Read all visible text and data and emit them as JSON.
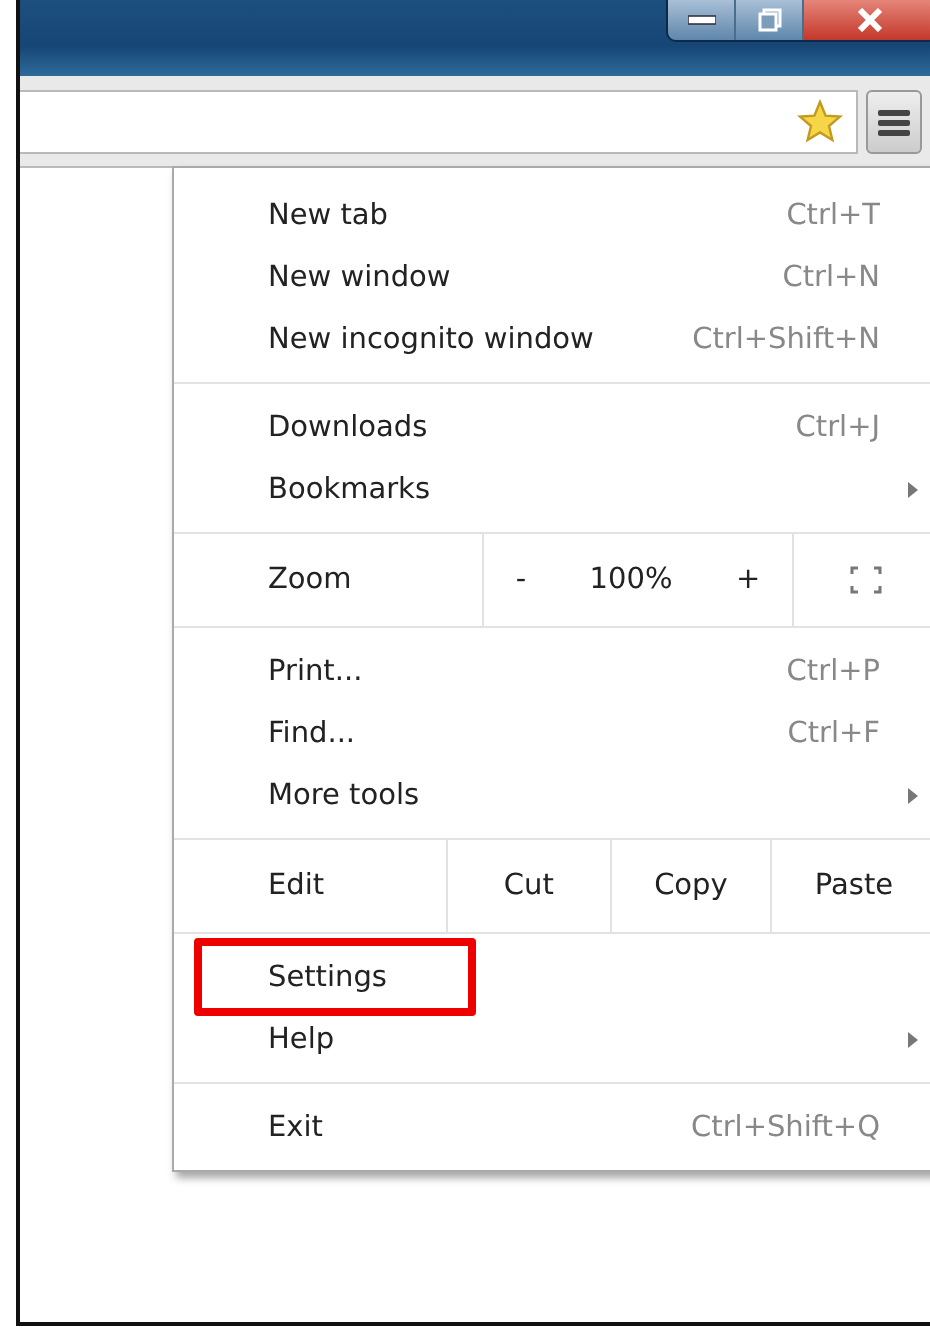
{
  "toolbar": {
    "bookmarked": true
  },
  "menu": {
    "sections": [
      {
        "items": [
          {
            "kind": "item",
            "label": "New tab",
            "shortcut": "Ctrl+T",
            "submenu": false,
            "highlighted": false
          },
          {
            "kind": "item",
            "label": "New window",
            "shortcut": "Ctrl+N",
            "submenu": false,
            "highlighted": false
          },
          {
            "kind": "item",
            "label": "New incognito window",
            "shortcut": "Ctrl+Shift+N",
            "submenu": false,
            "highlighted": false
          }
        ]
      },
      {
        "items": [
          {
            "kind": "item",
            "label": "Downloads",
            "shortcut": "Ctrl+J",
            "submenu": false,
            "highlighted": false
          },
          {
            "kind": "item",
            "label": "Bookmarks",
            "submenu": true,
            "highlighted": false
          }
        ]
      },
      {
        "items": [
          {
            "kind": "zoom",
            "label": "Zoom",
            "minus": "-",
            "level_text": "100%",
            "plus": "+"
          }
        ]
      },
      {
        "items": [
          {
            "kind": "item",
            "label": "Print...",
            "shortcut": "Ctrl+P",
            "submenu": false,
            "highlighted": false
          },
          {
            "kind": "item",
            "label": "Find...",
            "shortcut": "Ctrl+F",
            "submenu": false,
            "highlighted": false
          },
          {
            "kind": "item",
            "label": "More tools",
            "submenu": true,
            "highlighted": false
          }
        ]
      },
      {
        "items": [
          {
            "kind": "edit",
            "label": "Edit",
            "buttons": [
              "Cut",
              "Copy",
              "Paste"
            ]
          }
        ]
      },
      {
        "items": [
          {
            "kind": "item",
            "label": "Settings",
            "submenu": false,
            "highlighted": true
          },
          {
            "kind": "item",
            "label": "Help",
            "submenu": true,
            "highlighted": false
          }
        ]
      },
      {
        "items": [
          {
            "kind": "item",
            "label": "Exit",
            "shortcut": "Ctrl+Shift+Q",
            "submenu": false,
            "highlighted": false
          }
        ]
      }
    ]
  }
}
